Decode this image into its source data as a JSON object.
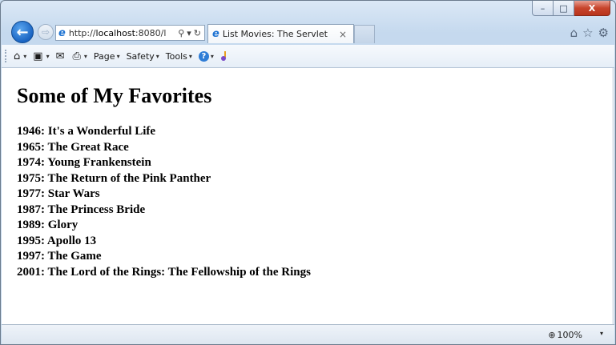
{
  "window": {
    "controls": {
      "minimize": "–",
      "maximize": "□",
      "close": "X"
    }
  },
  "nav": {
    "back_glyph": "←",
    "forward_glyph": "⇨",
    "address_prefix": "http://",
    "address_host": "localhost",
    "address_suffix": ":8080/l",
    "search_glyph": "⚲",
    "dropdown_glyph": "▾",
    "refresh_glyph": "↻"
  },
  "tab": {
    "title": "List Movies: The Servlet",
    "close_glyph": "×"
  },
  "rightnav": {
    "home_glyph": "⌂",
    "favorites_glyph": "☆",
    "settings_glyph": "⚙"
  },
  "commandbar": {
    "page_label": "Page",
    "safety_label": "Safety",
    "tools_label": "Tools",
    "help_glyph": "?",
    "home_glyph": "⌂",
    "feeds_glyph": "▣",
    "mail_glyph": "✉",
    "print_glyph": "⎙",
    "dropdown_glyph": "▾"
  },
  "page": {
    "heading": "Some of My Favorites",
    "movies": [
      "1946: It's a Wonderful Life",
      "1965: The Great Race",
      "1974: Young Frankenstein",
      "1975: The Return of the Pink Panther",
      "1977: Star Wars",
      "1987: The Princess Bride",
      "1989: Glory",
      "1995: Apollo 13",
      "1997: The Game",
      "2001: The Lord of the Rings: The Fellowship of the Rings"
    ]
  },
  "statusbar": {
    "zoom_glyph": "⊕",
    "zoom": "100%",
    "dropdown_glyph": "▾"
  },
  "colors": {
    "accent": "#1a64c2",
    "close": "#c7452c"
  }
}
